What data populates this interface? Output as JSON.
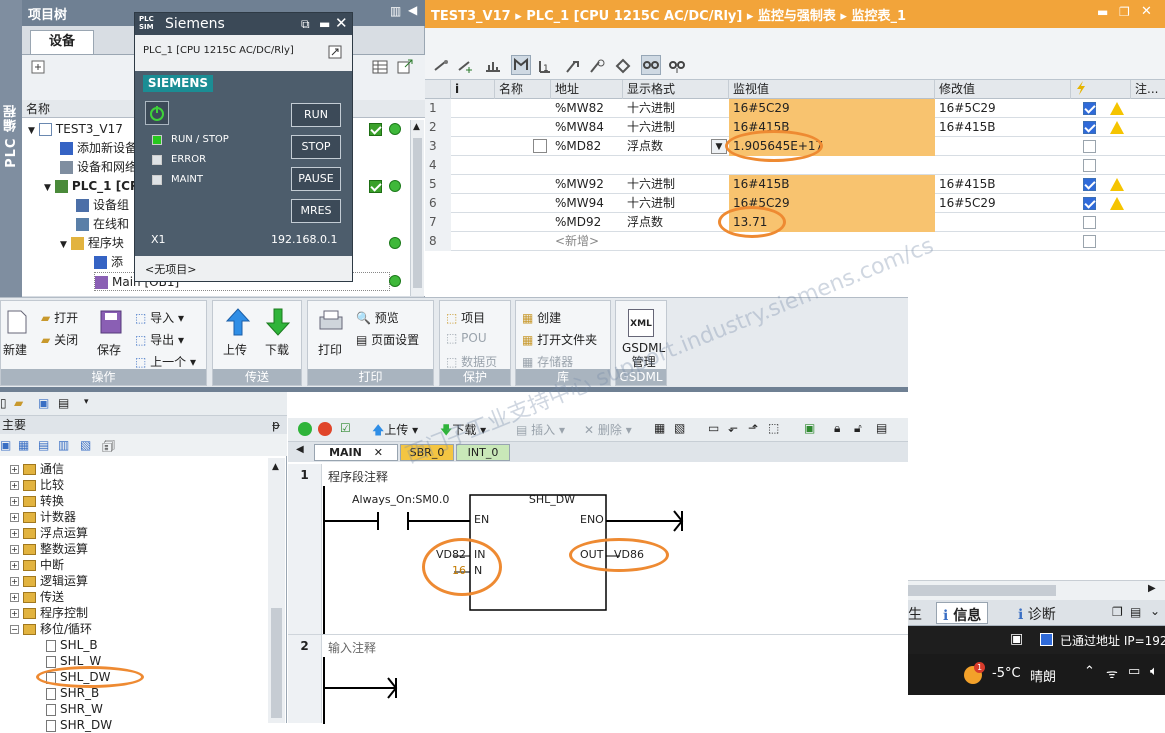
{
  "project_tree": {
    "side_label": "PLC 编程",
    "title": "项目树",
    "tab_devices": "设备",
    "col_name": "名称",
    "items": [
      {
        "label": "TEST3_V17"
      },
      {
        "label": "添加新设备"
      },
      {
        "label": "设备和网络"
      },
      {
        "label": "PLC_1 [CP"
      },
      {
        "label": "设备组"
      },
      {
        "label": "在线和"
      },
      {
        "label": "程序块"
      },
      {
        "label": "添"
      },
      {
        "label": "Main [OB1]"
      }
    ]
  },
  "plcsim": {
    "logo": "PLC SIM",
    "title": "Siemens",
    "cpu": "PLC_1 [CPU 1215C AC/DC/Rly]",
    "brand": "SIEMENS",
    "leds": [
      "RUN / STOP",
      "ERROR",
      "MAINT"
    ],
    "buttons": [
      "RUN",
      "STOP",
      "PAUSE",
      "MRES"
    ],
    "port": "X1",
    "ip": "192.168.0.1",
    "project": "<无项目>"
  },
  "watch": {
    "breadcrumb": "TEST3_V17  ▸  PLC_1 [CPU 1215C AC/DC/Rly]  ▸  监控与强制表  ▸  监控表_1",
    "headers": {
      "index": "i",
      "name": "名称",
      "address": "地址",
      "format": "显示格式",
      "monitor": "监视值",
      "modify": "修改值",
      "comment": "注..."
    },
    "rows": [
      {
        "no": "1",
        "address": "%MW82",
        "format": "十六进制",
        "monitor": "16#5C29",
        "modify": "16#5C29",
        "checked": true,
        "warn": true
      },
      {
        "no": "2",
        "address": "%MW84",
        "format": "十六进制",
        "monitor": "16#415B",
        "modify": "16#415B",
        "checked": true,
        "warn": true
      },
      {
        "no": "3",
        "address": "%MD82",
        "format": "浮点数",
        "monitor": "1.905645E+17",
        "modify": "",
        "checked": false,
        "warn": false
      },
      {
        "no": "4",
        "address": "",
        "format": "",
        "monitor": "",
        "modify": "",
        "checked": false,
        "warn": false
      },
      {
        "no": "5",
        "address": "%MW92",
        "format": "十六进制",
        "monitor": "16#415B",
        "modify": "16#415B",
        "checked": true,
        "warn": true
      },
      {
        "no": "6",
        "address": "%MW94",
        "format": "十六进制",
        "monitor": "16#5C29",
        "modify": "16#5C29",
        "checked": true,
        "warn": true
      },
      {
        "no": "7",
        "address": "%MD92",
        "format": "浮点数",
        "monitor": "13.71",
        "modify": "",
        "checked": false,
        "warn": false
      },
      {
        "no": "8",
        "address": "<新增>",
        "format": "",
        "monitor": "",
        "modify": "",
        "checked": false,
        "warn": false
      }
    ]
  },
  "ribbon": {
    "groups": [
      {
        "label": "操作",
        "items": [
          "新建",
          "打开",
          "关闭",
          "保存",
          "导入",
          "导出",
          "上一个"
        ]
      },
      {
        "label": "传送",
        "items": [
          "上传",
          "下载"
        ]
      },
      {
        "label": "打印",
        "items": [
          "打印",
          "预览",
          "页面设置"
        ]
      },
      {
        "label": "保护",
        "items": [
          "项目",
          "POU",
          "数据页"
        ]
      },
      {
        "label": "库",
        "items": [
          "创建",
          "打开文件夹",
          "存储器"
        ]
      },
      {
        "label": "GSDML",
        "items": [
          "GSDML",
          "管理"
        ]
      }
    ],
    "xml_icon": "XML"
  },
  "instr_tree": {
    "header": "主要",
    "pin": "ᵽ",
    "items": [
      {
        "label": "通信",
        "kind": "folder"
      },
      {
        "label": "比较",
        "kind": "folder"
      },
      {
        "label": "转换",
        "kind": "folder"
      },
      {
        "label": "计数器",
        "kind": "folder"
      },
      {
        "label": "浮点运算",
        "kind": "folder"
      },
      {
        "label": "整数运算",
        "kind": "folder"
      },
      {
        "label": "中断",
        "kind": "folder"
      },
      {
        "label": "逻辑运算",
        "kind": "folder"
      },
      {
        "label": "传送",
        "kind": "folder"
      },
      {
        "label": "程序控制",
        "kind": "folder"
      },
      {
        "label": "移位/循环",
        "kind": "folder-open"
      },
      {
        "label": "SHL_B",
        "kind": "leaf"
      },
      {
        "label": "SHL_W",
        "kind": "leaf"
      },
      {
        "label": "SHL_DW",
        "kind": "leaf"
      },
      {
        "label": "SHR_B",
        "kind": "leaf"
      },
      {
        "label": "SHR_W",
        "kind": "leaf"
      },
      {
        "label": "SHR_DW",
        "kind": "leaf"
      }
    ]
  },
  "editor": {
    "toolbar": {
      "upload": "上传",
      "download": "下载",
      "insert": "插入",
      "delete": "删除"
    },
    "tabs": [
      "MAIN",
      "SBR_0",
      "INT_0"
    ],
    "network1": {
      "no": "1",
      "comment": "程序段注释",
      "contact": "Always_On:SM0.0",
      "block": "SHL_DW",
      "en": "EN",
      "eno": "ENO",
      "in_label": "IN",
      "n_label": "N",
      "out_label": "OUT",
      "in_operand": "VD82",
      "n_operand": "16",
      "out_operand": "VD86"
    },
    "network2": {
      "no": "2",
      "comment": "输入注释"
    }
  },
  "right_panes": {
    "tab_partial": "生",
    "tab_info": "信息",
    "tab_diag": "诊断",
    "status": "已通过地址 IP=192"
  },
  "taskbar": {
    "temp": "-5°C",
    "weather": "晴朗",
    "badge": "1"
  },
  "watermark": "西门子工业支持中心 support.industry.siemens.com/cs",
  "colors": {
    "orange_header": "#f2a43a",
    "monitor_cell": "#f8c36f",
    "highlight_ring": "#ee8a32",
    "plcsim_bg": "#4d5d6c",
    "siemens_teal": "#1b8d94"
  }
}
